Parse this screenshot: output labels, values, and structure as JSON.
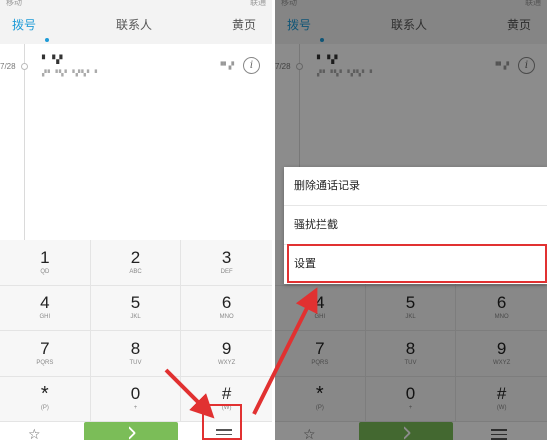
{
  "status_bar": {
    "left": "移动",
    "right": "联通"
  },
  "tabs": [
    {
      "label": "拨号",
      "active": true
    },
    {
      "label": "联系人",
      "active": false
    },
    {
      "label": "黄页",
      "active": false
    }
  ],
  "call_log": {
    "date": "7/28",
    "name": "▘▝▞",
    "detail": "▞▘▝▚▘▝▞▚▘▝",
    "time": "▝▘▞",
    "info_icon": "i"
  },
  "keypad": [
    {
      "num": "1",
      "sub": "QD"
    },
    {
      "num": "2",
      "sub": "ABC"
    },
    {
      "num": "3",
      "sub": "DEF"
    },
    {
      "num": "4",
      "sub": "GHI"
    },
    {
      "num": "5",
      "sub": "JKL"
    },
    {
      "num": "6",
      "sub": "MNO"
    },
    {
      "num": "7",
      "sub": "PQRS"
    },
    {
      "num": "8",
      "sub": "TUV"
    },
    {
      "num": "9",
      "sub": "WXYZ"
    },
    {
      "num": "*",
      "sub": "(P)"
    },
    {
      "num": "0",
      "sub": "+"
    },
    {
      "num": "#",
      "sub": "(W)"
    }
  ],
  "bottom": {
    "fav_icon": "star-icon",
    "call_icon": "phone-icon",
    "menu_icon": "menu-icon"
  },
  "popup_menu": [
    {
      "label": "删除通话记录"
    },
    {
      "label": "骚扰拦截"
    },
    {
      "label": "设置"
    }
  ],
  "colors": {
    "accent": "#1e9bd7",
    "call_green": "#7bbd58",
    "highlight_red": "#e13131"
  }
}
